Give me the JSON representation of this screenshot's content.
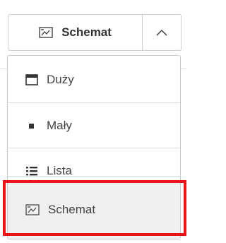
{
  "toolbar": {
    "view_label": "Schemat",
    "view_icon": "schema-icon",
    "toggle_icon": "chevron-up-icon"
  },
  "menu": {
    "items": [
      {
        "label": "Duży",
        "icon": "large-view-icon",
        "selected": false
      },
      {
        "label": "Mały",
        "icon": "small-view-icon",
        "selected": false
      },
      {
        "label": "Lista",
        "icon": "list-view-icon",
        "selected": false
      },
      {
        "label": "Schemat",
        "icon": "schema-icon",
        "selected": true
      }
    ]
  },
  "colors": {
    "highlight": "#e8161b",
    "selected_background": "#eef0f2",
    "border": "#cfcfcf"
  }
}
